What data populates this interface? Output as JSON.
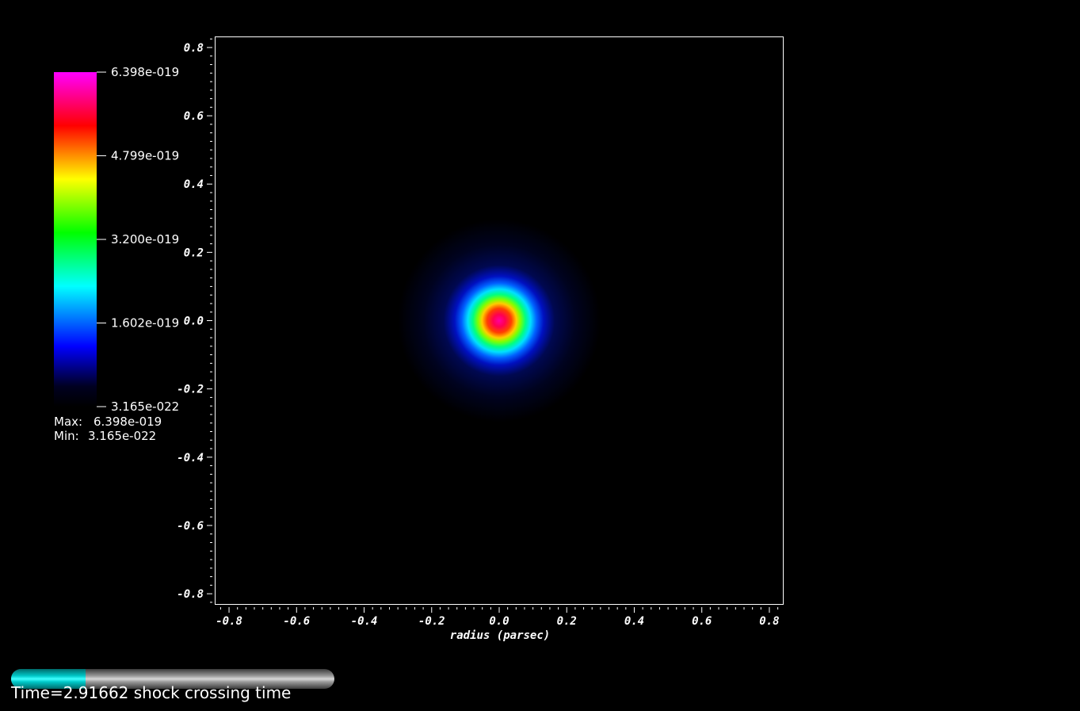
{
  "chart_data": {
    "type": "heatmap",
    "title": "",
    "xlabel": "radius (parsec)",
    "ylabel": "",
    "xlim": [
      -0.84,
      0.84
    ],
    "ylim": [
      -0.83,
      0.83
    ],
    "x_ticks": [
      "-0.8",
      "-0.6",
      "-0.4",
      "-0.2",
      "0.0",
      "0.2",
      "0.4",
      "0.6",
      "0.8"
    ],
    "y_ticks": [
      "0.8",
      "0.6",
      "0.4",
      "0.2",
      "0.0",
      "-0.2",
      "-0.4",
      "-0.6",
      "-0.8"
    ],
    "x_tick_values": [
      -0.8,
      -0.6,
      -0.4,
      -0.2,
      0.0,
      0.2,
      0.4,
      0.6,
      0.8
    ],
    "y_tick_values": [
      0.8,
      0.6,
      0.4,
      0.2,
      0.0,
      -0.2,
      -0.4,
      -0.6,
      -0.8
    ],
    "field": {
      "center": [
        0.0,
        0.0
      ],
      "core_radius": 0.075,
      "halo_radius": 0.3,
      "max": 6.398e-19,
      "min": 3.165e-22
    },
    "colorbar": {
      "labels": [
        "6.398e-019",
        "4.799e-019",
        "3.200e-019",
        "1.602e-019",
        "3.165e-022"
      ],
      "values": [
        6.398e-19,
        4.799e-19,
        3.2e-19,
        1.602e-19,
        3.165e-22
      ],
      "colors": [
        "#000000",
        "#0000ff",
        "#00ffff",
        "#00ff00",
        "#ffff00",
        "#ff0000",
        "#ff00ff"
      ]
    }
  },
  "stats": {
    "max_label": "Max:",
    "max_value": "6.398e-019",
    "min_label": "Min:",
    "min_value": "3.165e-022"
  },
  "time": {
    "label": "Time=2.91662 shock crossing time",
    "progress": 0.23
  }
}
